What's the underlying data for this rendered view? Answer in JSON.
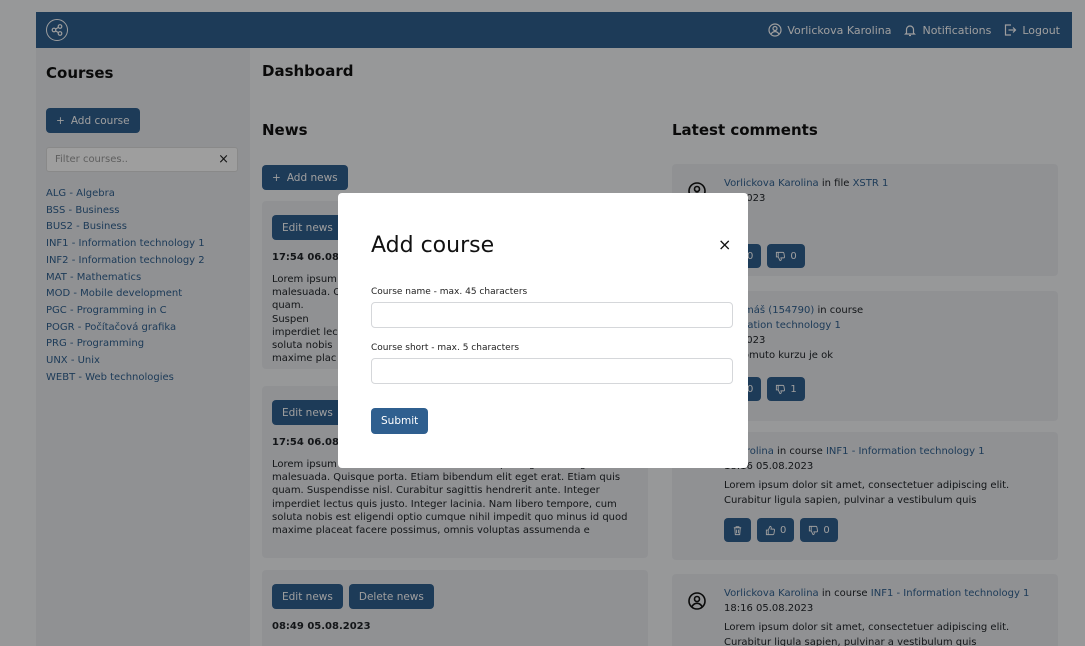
{
  "topbar": {
    "user_name": "Vorlickova Karolina",
    "notifications_label": "Notifications",
    "logout_label": "Logout"
  },
  "sidebar": {
    "title": "Courses",
    "add_course_label": "Add course",
    "filter_placeholder": "Filter courses..",
    "courses": [
      "ALG - Algebra",
      "BSS - Business",
      "BUS2 - Business",
      "INF1 - Information technology 1",
      "INF2 - Information technology 2",
      "MAT - Mathematics",
      "MOD - Mobile development",
      "PGC - Programming in C",
      "POGR - Počítačová grafika",
      "PRG - Programming",
      "UNX - Unix",
      "WEBT - Web technologies"
    ]
  },
  "main": {
    "title": "Dashboard",
    "news_title": "News",
    "add_news_label": "Add news",
    "comments_title": "Latest comments"
  },
  "news": [
    {
      "edit_label": "Edit news",
      "time": "17:54 06.08.",
      "body": "Lorem ipsum malesuada. Q quam. Suspen imperdiet lec soluta nobis maxime plac"
    },
    {
      "edit_label": "Edit news",
      "time": "17:54 06.08.",
      "body": "Lorem ipsum dolor sit amet, consectetuer adipiscing elit. Integer malesuada. Quisque porta. Etiam bibendum elit eget erat. Etiam quis quam. Suspendisse nisl. Curabitur sagittis hendrerit ante. Integer imperdiet lectus quis justo. Integer lacinia. Nam libero tempore, cum soluta nobis est eligendi optio cumque nihil impedit quo minus id quod maxime placeat facere possimus, omnis voluptas assumenda e"
    },
    {
      "edit_label": "Edit news",
      "delete_label": "Delete news",
      "time": "08:49 05.08.2023"
    }
  ],
  "comments": [
    {
      "author": "Vorlickova Karolina",
      "connector": "in file",
      "target": "XSTR 1",
      "time": "08.2023",
      "likes": "0",
      "dislikes": "0"
    },
    {
      "author": "n Tomáš (154790)",
      "connector": "in course",
      "target": "formation technology 1",
      "time": "08.2023",
      "text": "í k tomuto kurzu je ok",
      "likes": "0",
      "dislikes": "1"
    },
    {
      "author": "a Karolina",
      "connector": "in course",
      "target": "INF1 - Information technology 1",
      "time": "18:16 05.08.2023",
      "text": "Lorem ipsum dolor sit amet, consectetuer adipiscing elit. Curabitur ligula sapien, pulvinar a vestibulum quis",
      "likes": "0",
      "dislikes": "0"
    },
    {
      "author": "Vorlickova Karolina",
      "connector": "in course",
      "target": "INF1 - Information technology 1",
      "time": "18:16 05.08.2023",
      "text": "Lorem ipsum dolor sit amet, consectetuer adipiscing elit. Curabitur ligula sapien, pulvinar a vestibulum quis"
    }
  ],
  "modal": {
    "title": "Add course",
    "close_symbol": "×",
    "name_label": "Course name - max. 45 characters",
    "short_label": "Course short - max. 5 characters",
    "submit_label": "Submit"
  },
  "colors": {
    "primary": "#2f5f8f",
    "card_bg": "#e9ebee"
  },
  "icons": [
    "share-icon",
    "user-circle-icon",
    "bell-icon",
    "logout-icon",
    "plus-icon",
    "close-icon",
    "thumbs-up-icon",
    "thumbs-down-icon",
    "trash-icon"
  ]
}
